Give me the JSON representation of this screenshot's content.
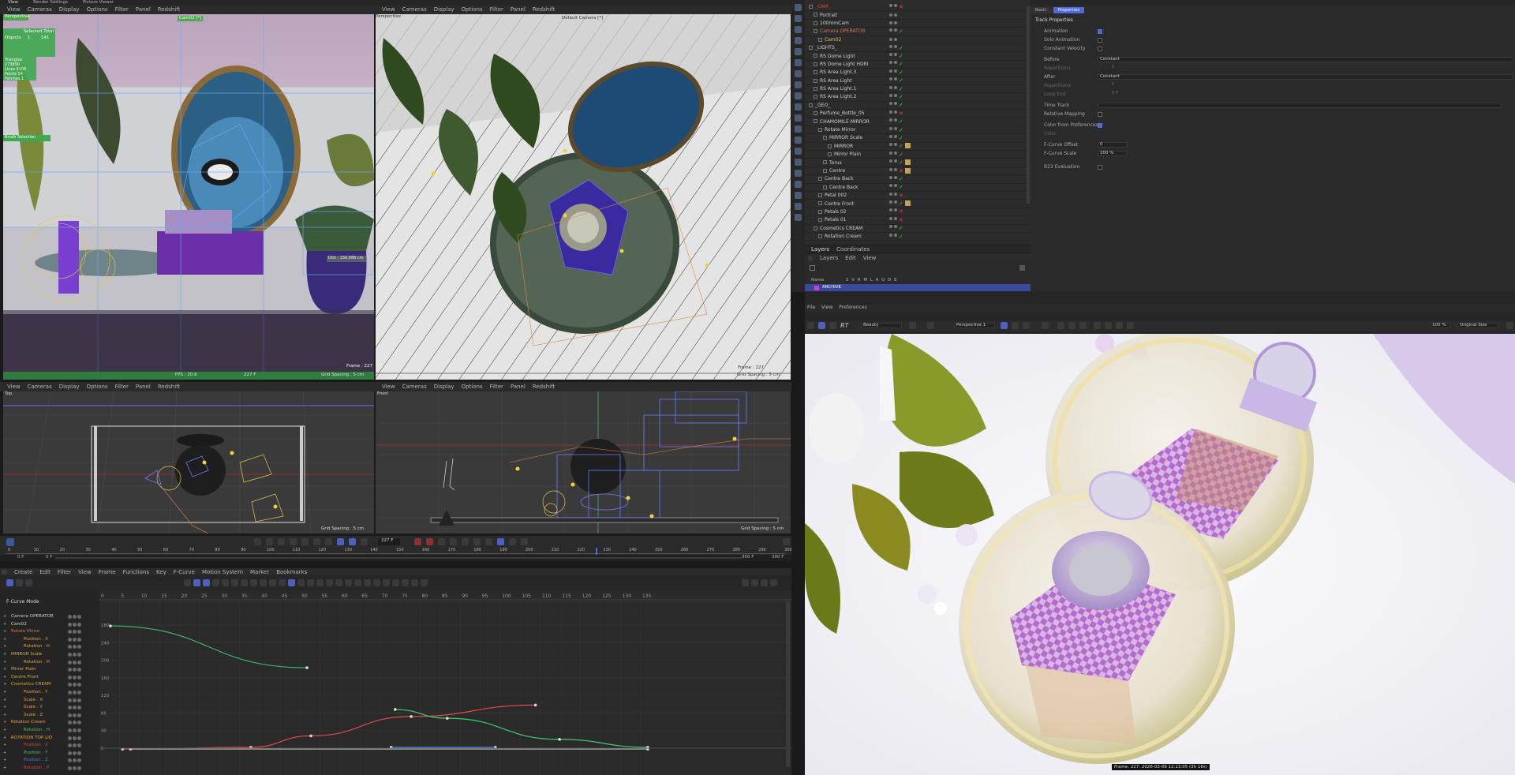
{
  "top_strip": {
    "tabs": [
      "View",
      "Render Settings",
      "Picture Viewer"
    ]
  },
  "viewports": [
    {
      "menu": [
        "View",
        "Cameras",
        "Display",
        "Options",
        "Filter",
        "Panel",
        "Redshift"
      ],
      "name": "Perspective",
      "camera": "Cam02 [*]",
      "hud": {
        "selected_total": "Selected Total",
        "objects": "Objects",
        "objects_sel": "1",
        "objects_total": "141",
        "triangles": "Triangles 273890",
        "lines": "Lines",
        "lines_val": "4106",
        "points": "Points",
        "points_val": "54",
        "patches": "Patches",
        "patches_val": "1",
        "brush_sel": "Brush Selection"
      },
      "fps": "FPS : 20.6",
      "frame": "227 F",
      "grid": "Grid Spacing : 5 cm",
      "frame_r": "Frame : 227",
      "dist": "Dist : 150.586 cm"
    },
    {
      "menu": [
        "View",
        "Cameras",
        "Display",
        "Options",
        "Filter",
        "Panel",
        "Redshift"
      ],
      "name": "Perspective",
      "camera": "Default Camera [*]",
      "grid": "Grid Spacing : 5 cm",
      "frame_r": "Frame : 227"
    },
    {
      "menu": [
        "View",
        "Cameras",
        "Display",
        "Options",
        "Filter",
        "Panel",
        "Redshift"
      ],
      "name": "Top",
      "grid": "Grid Spacing : 5 cm"
    },
    {
      "menu": [
        "View",
        "Cameras",
        "Display",
        "Options",
        "Filter",
        "Panel",
        "Redshift"
      ],
      "name": "Front",
      "grid": "Grid Spacing : 5 cm"
    }
  ],
  "timeline": {
    "current_frame": "227 F",
    "start": "0 F",
    "start2": "0 F",
    "end": "300 F",
    "end2": "300 F",
    "ruler": [
      "0",
      "10",
      "20",
      "30",
      "40",
      "50",
      "60",
      "70",
      "80",
      "90",
      "100",
      "110",
      "120",
      "130",
      "140",
      "150",
      "160",
      "170",
      "180",
      "190",
      "200",
      "210",
      "220",
      "230",
      "240",
      "250",
      "260",
      "270",
      "280",
      "290",
      "300"
    ]
  },
  "fcurve": {
    "menu": [
      "Create",
      "Edit",
      "Filter",
      "View",
      "Frame",
      "Functions",
      "Key",
      "F-Curve",
      "Motion System",
      "Marker",
      "Bookmarks"
    ],
    "mode": "F-Curve Mode",
    "x_ticks": [
      "0",
      "5",
      "10",
      "15",
      "20",
      "25",
      "30",
      "35",
      "40",
      "45",
      "50",
      "55",
      "60",
      "65",
      "70",
      "75",
      "80",
      "85",
      "90",
      "95",
      "100",
      "105",
      "110",
      "115",
      "120",
      "125",
      "130",
      "135"
    ],
    "y_ticks": [
      "280",
      "240",
      "200",
      "160",
      "120",
      "80",
      "40",
      "0"
    ],
    "tracks": [
      {
        "label": "Camera OPERATOR",
        "color": "#cfcfcf",
        "indent": 0
      },
      {
        "label": "Cam02",
        "color": "#cfcfcf",
        "indent": 0
      },
      {
        "label": "Rotate Mirror",
        "color": "#e0703a",
        "indent": 0
      },
      {
        "label": "Position . X",
        "color": "#e8a23a",
        "indent": 1
      },
      {
        "label": "Rotation . H",
        "color": "#e8a23a",
        "indent": 1
      },
      {
        "label": "MIRROR Scale",
        "color": "#e8a23a",
        "indent": 0
      },
      {
        "label": "Rotation . H",
        "color": "#e8a23a",
        "indent": 1
      },
      {
        "label": "Mirror Plain",
        "color": "#e8a23a",
        "indent": 0
      },
      {
        "label": "Centre Front",
        "color": "#e8a23a",
        "indent": 0
      },
      {
        "label": "Cosmetics CREAM",
        "color": "#e8a23a",
        "indent": 0
      },
      {
        "label": "Position . Y",
        "color": "#e8a23a",
        "indent": 1
      },
      {
        "label": "Scale . X",
        "color": "#e8a23a",
        "indent": 1
      },
      {
        "label": "Scale . Y",
        "color": "#e8a23a",
        "indent": 1
      },
      {
        "label": "Scale . Z",
        "color": "#e8a23a",
        "indent": 1
      },
      {
        "label": "Rotation Cream",
        "color": "#e8a23a",
        "indent": 0
      },
      {
        "label": "Rotation . H",
        "color": "#4ec44e",
        "indent": 1
      },
      {
        "label": "ROTATION TOP LID",
        "color": "#e8a23a",
        "indent": 0
      },
      {
        "label": "Position . X",
        "color": "#e04040",
        "indent": 1
      },
      {
        "label": "Position . Y",
        "color": "#4ec44e",
        "indent": 1
      },
      {
        "label": "Position . Z",
        "color": "#4a7ae0",
        "indent": 1
      },
      {
        "label": "Rotation . P",
        "color": "#e04040",
        "indent": 1
      }
    ],
    "curves": [
      {
        "color": "#3fae6e",
        "points": [
          [
            0,
            278
          ],
          [
            49,
            183
          ]
        ]
      },
      {
        "color": "#e04a4a",
        "points": [
          [
            3,
            -2
          ],
          [
            35,
            2
          ],
          [
            50,
            28
          ],
          [
            75,
            72
          ],
          [
            106,
            98
          ]
        ]
      },
      {
        "color": "#3fd06e",
        "points": [
          [
            71,
            88
          ],
          [
            84,
            68
          ],
          [
            112,
            20
          ],
          [
            134,
            2
          ]
        ]
      },
      {
        "color": "#4a7ae0",
        "points": [
          [
            70,
            2
          ],
          [
            96,
            2
          ]
        ]
      },
      {
        "color": "#aaaaaa",
        "points": [
          [
            5,
            -2
          ],
          [
            134,
            -2
          ]
        ]
      }
    ]
  },
  "object_manager": {
    "rows": [
      {
        "name": "_CAM_",
        "level": 0,
        "color": "#e04040",
        "flags": "x"
      },
      {
        "name": "Portrait",
        "level": 1,
        "color": "#cfcfcf",
        "flags": "dots"
      },
      {
        "name": "100mmCam",
        "level": 1,
        "color": "#cfcfcf",
        "flags": "dots"
      },
      {
        "name": "Camera OPERATOR",
        "level": 1,
        "color": "#e0703a",
        "flags": "check"
      },
      {
        "name": "Cam02",
        "level": 2,
        "color": "#e8c23a",
        "flags": "dots"
      },
      {
        "name": "_LIGHTS_",
        "level": 0,
        "color": "#cfcfcf",
        "flags": "check"
      },
      {
        "name": "RS Dome Light",
        "level": 1,
        "color": "#cfcfcf",
        "flags": "check"
      },
      {
        "name": "RS Dome Light HDRI",
        "level": 1,
        "color": "#cfcfcf",
        "flags": "check"
      },
      {
        "name": "RS Area Light.3",
        "level": 1,
        "color": "#cfcfcf",
        "flags": "check"
      },
      {
        "name": "RS Area Light",
        "level": 1,
        "color": "#cfcfcf",
        "flags": "check"
      },
      {
        "name": "RS Area Light.1",
        "level": 1,
        "color": "#cfcfcf",
        "flags": "check"
      },
      {
        "name": "RS Area Light.2",
        "level": 1,
        "color": "#cfcfcf",
        "flags": "check"
      },
      {
        "name": "_GEO_",
        "level": 0,
        "color": "#cfcfcf",
        "flags": "check"
      },
      {
        "name": "Perfume_Bottle_05",
        "level": 1,
        "color": "#cfcfcf",
        "flags": "x"
      },
      {
        "name": "CHAMOMILE MIRROR",
        "level": 1,
        "color": "#cfcfcf",
        "flags": "check"
      },
      {
        "name": "Rotate Mirror",
        "level": 2,
        "color": "#cfcfcf",
        "flags": "check"
      },
      {
        "name": "MIRROR Scale",
        "level": 3,
        "color": "#cfcfcf",
        "flags": "check"
      },
      {
        "name": "MIRROR",
        "level": 4,
        "color": "#cfcfcf",
        "flags": "checktag"
      },
      {
        "name": "Mirror Plain",
        "level": 4,
        "color": "#cfcfcf",
        "flags": "check"
      },
      {
        "name": "Torus",
        "level": 3,
        "color": "#cfcfcf",
        "flags": "checktag"
      },
      {
        "name": "Centre",
        "level": 3,
        "color": "#cfcfcf",
        "flags": "xtag"
      },
      {
        "name": "Centre Back",
        "level": 2,
        "color": "#cfcfcf",
        "flags": "check"
      },
      {
        "name": "Centre Back",
        "level": 3,
        "color": "#cfcfcf",
        "flags": "check"
      },
      {
        "name": "Petal 002",
        "level": 2,
        "color": "#cfcfcf",
        "flags": "x"
      },
      {
        "name": "Centre Front",
        "level": 2,
        "color": "#cfcfcf",
        "flags": "checktag"
      },
      {
        "name": "Petals 02",
        "level": 2,
        "color": "#cfcfcf",
        "flags": "x"
      },
      {
        "name": "Petals 01",
        "level": 2,
        "color": "#cfcfcf",
        "flags": "x"
      },
      {
        "name": "Cosmetics CREAM",
        "level": 1,
        "color": "#cfcfcf",
        "flags": "check"
      },
      {
        "name": "Rotation Cream",
        "level": 2,
        "color": "#cfcfcf",
        "flags": "check"
      }
    ],
    "bottom_tabs": [
      "Layers",
      "Coordinates"
    ],
    "layers_menu": [
      "Layers",
      "Edit",
      "View"
    ],
    "layers_header": "Name",
    "layers_cols": "S V R M L A G D E",
    "layer_name": "ARCHIVE"
  },
  "attributes": {
    "tabs": [
      "Basic",
      "Properties"
    ],
    "section": "Track Properties",
    "props": [
      {
        "label": "Animation",
        "type": "check",
        "value": true
      },
      {
        "label": "Solo Animation",
        "type": "check",
        "value": false
      },
      {
        "label": "Constant Velocity",
        "type": "check",
        "value": false
      },
      {
        "label": "Before",
        "type": "select",
        "value": "Constant"
      },
      {
        "label": "Repetitions",
        "type": "text",
        "value": "0"
      },
      {
        "label": "After",
        "type": "select",
        "value": "Constant"
      },
      {
        "label": "Repetitions",
        "type": "text",
        "value": "0"
      },
      {
        "label": "Loop End",
        "type": "text",
        "value": "0 F"
      },
      {
        "label": "Time Track",
        "type": "wide",
        "value": ""
      },
      {
        "label": "Relative Mapping",
        "type": "check",
        "value": false
      },
      {
        "label": "Color from Preferences",
        "type": "check",
        "value": true
      },
      {
        "label": "Color",
        "type": "text",
        "value": ""
      },
      {
        "label": "F-Curve Offset",
        "type": "num",
        "value": "0"
      },
      {
        "label": "F-Curve Scale",
        "type": "num",
        "value": "100 %"
      },
      {
        "label": "R23 Evaluation",
        "type": "check",
        "value": false
      }
    ]
  },
  "picture_viewer": {
    "menu": [
      "File",
      "View",
      "Preferences"
    ],
    "rt_label": "RT",
    "beauty": "Beauty",
    "camera": "Perspective.1",
    "zoom": "100 %",
    "size": "Original Size",
    "status": "Frame: 227: 2026-03-09 12:13:05 (3h 18s)"
  },
  "colors": {
    "accent": "#4f6ad9",
    "selection": "#3a4a9a",
    "render_bg": "#efeef4"
  }
}
